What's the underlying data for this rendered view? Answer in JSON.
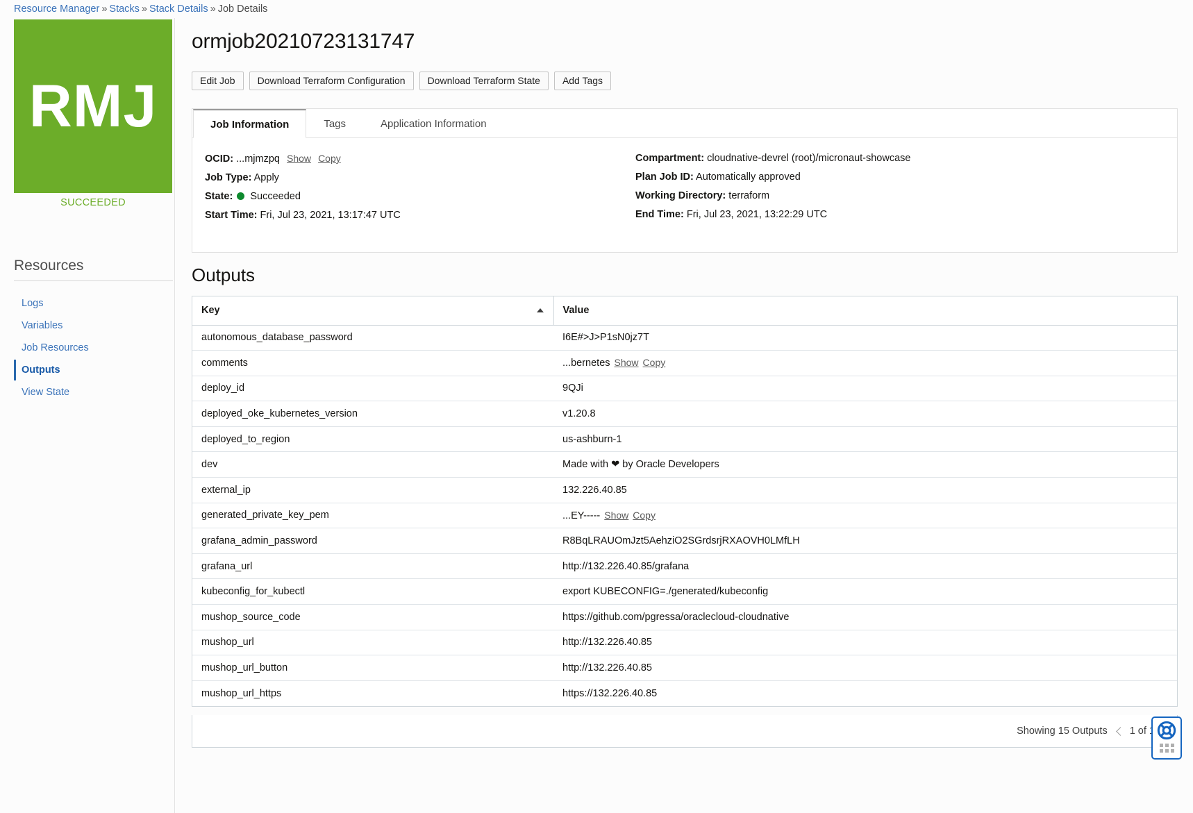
{
  "breadcrumb": {
    "items": [
      {
        "label": "Resource Manager",
        "link": true
      },
      {
        "label": "Stacks",
        "link": true
      },
      {
        "label": "Stack Details",
        "link": true
      },
      {
        "label": "Job Details",
        "link": false
      }
    ],
    "separator": "»"
  },
  "sidebar": {
    "tile_label": "RMJ",
    "tile_color": "#6cad29",
    "state_caption": "SUCCEEDED",
    "resources_title": "Resources",
    "items": [
      {
        "label": "Logs",
        "active": false
      },
      {
        "label": "Variables",
        "active": false
      },
      {
        "label": "Job Resources",
        "active": false
      },
      {
        "label": "Outputs",
        "active": true
      },
      {
        "label": "View State",
        "active": false
      }
    ]
  },
  "header": {
    "title": "ormjob20210723131747",
    "buttons": [
      {
        "label": "Edit Job"
      },
      {
        "label": "Download Terraform Configuration"
      },
      {
        "label": "Download Terraform State"
      },
      {
        "label": "Add Tags"
      }
    ]
  },
  "tabs": [
    {
      "label": "Job Information",
      "active": true
    },
    {
      "label": "Tags",
      "active": false
    },
    {
      "label": "Application Information",
      "active": false
    }
  ],
  "job_info": {
    "left": {
      "ocid_label": "OCID:",
      "ocid_value": "...mjmzpq",
      "ocid_show": "Show",
      "ocid_copy": "Copy",
      "job_type_label": "Job Type:",
      "job_type_value": "Apply",
      "state_label": "State:",
      "state_value": "Succeeded",
      "state_color": "#0e8a2e",
      "start_time_label": "Start Time:",
      "start_time_value": "Fri, Jul 23, 2021, 13:17:47 UTC"
    },
    "right": {
      "compartment_label": "Compartment:",
      "compartment_value": "cloudnative-devrel (root)/micronaut-showcase",
      "plan_job_id_label": "Plan Job ID:",
      "plan_job_id_value": "Automatically approved",
      "working_directory_label": "Working Directory:",
      "working_directory_value": "terraform",
      "end_time_label": "End Time:",
      "end_time_value": "Fri, Jul 23, 2021, 13:22:29 UTC"
    }
  },
  "outputs": {
    "section_title": "Outputs",
    "columns": {
      "key": "Key",
      "value": "Value"
    },
    "sort": {
      "column": "Key",
      "direction": "asc"
    },
    "rows": [
      {
        "key": "autonomous_database_password",
        "value": "I6E#>J>P1sN0jz7T",
        "actions": []
      },
      {
        "key": "comments",
        "value": "...bernetes",
        "actions": [
          "Show",
          "Copy"
        ]
      },
      {
        "key": "deploy_id",
        "value": "9QJi",
        "actions": []
      },
      {
        "key": "deployed_oke_kubernetes_version",
        "value": "v1.20.8",
        "actions": []
      },
      {
        "key": "deployed_to_region",
        "value": "us-ashburn-1",
        "actions": []
      },
      {
        "key": "dev",
        "value": "Made with ❤ by Oracle Developers",
        "actions": []
      },
      {
        "key": "external_ip",
        "value": "132.226.40.85",
        "actions": []
      },
      {
        "key": "generated_private_key_pem",
        "value": "...EY-----",
        "actions": [
          "Show",
          "Copy"
        ]
      },
      {
        "key": "grafana_admin_password",
        "value": "R8BqLRAUOmJzt5AehziO2SGrdsrjRXAOVH0LMfLH",
        "actions": []
      },
      {
        "key": "grafana_url",
        "value": "http://132.226.40.85/grafana",
        "actions": []
      },
      {
        "key": "kubeconfig_for_kubectl",
        "value": "export KUBECONFIG=./generated/kubeconfig",
        "actions": []
      },
      {
        "key": "mushop_source_code",
        "value": "https://github.com/pgressa/oraclecloud-cloudnative",
        "actions": []
      },
      {
        "key": "mushop_url",
        "value": "http://132.226.40.85",
        "actions": []
      },
      {
        "key": "mushop_url_button",
        "value": "http://132.226.40.85",
        "actions": []
      },
      {
        "key": "mushop_url_https",
        "value": "https://132.226.40.85",
        "actions": []
      }
    ],
    "footer": {
      "showing": "Showing 15 Outputs",
      "page_label": "1 of 1"
    }
  },
  "help_widget": {
    "icon": "life-ring-icon",
    "color": "#1565c0"
  }
}
